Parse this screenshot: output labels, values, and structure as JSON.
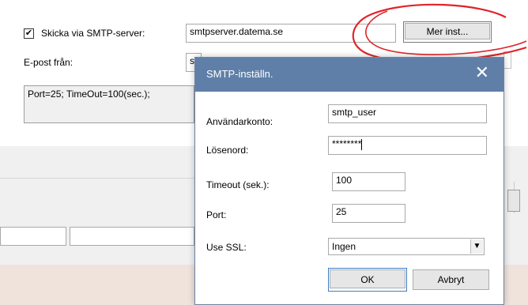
{
  "main": {
    "smtp_checkbox_label": "Skicka via SMTP-server:",
    "smtp_checked": true,
    "smtp_server_value": "smtpserver.datema.se",
    "more_settings_button": "Mer inst...",
    "from_label": "E-post från:",
    "from_value_partial": "s",
    "info_text": "Port=25; TimeOut=100(sec.);"
  },
  "dialog": {
    "title": "SMTP-inställn.",
    "account_label": "Användarkonto:",
    "account_value": "smtp_user",
    "password_label": "Lösenord:",
    "password_value": "********",
    "timeout_label": "Timeout (sek.):",
    "timeout_value": "100",
    "port_label": "Port:",
    "port_value": "25",
    "ssl_label": "Use SSL:",
    "ssl_value": "Ingen",
    "ok_button": "OK",
    "cancel_button": "Avbryt"
  },
  "colors": {
    "titlebar": "#5f7fa8",
    "annotation": "#e0242a"
  },
  "icons": {
    "close": "close-icon",
    "dropdown": "chevron-down-icon",
    "check": "checkmark-icon"
  }
}
